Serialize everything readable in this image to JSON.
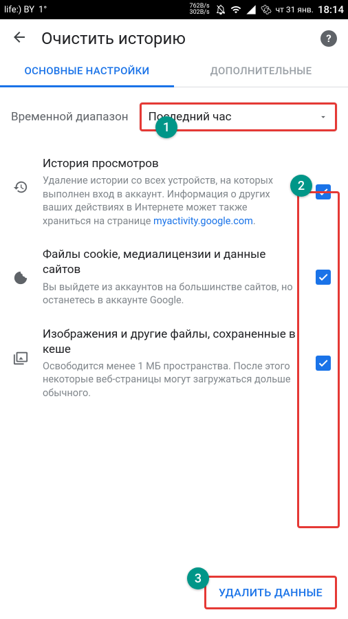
{
  "status": {
    "carrier": "life:) BY",
    "temp": "1°",
    "speed_down": "762B/s",
    "speed_up": "302B/s",
    "date": "чт 31 янв.",
    "time": "18:14"
  },
  "header": {
    "title": "Очистить историю",
    "help_glyph": "?"
  },
  "tabs": {
    "basic": "ОСНОВНЫЕ НАСТРОЙКИ",
    "advanced": "ДОПОЛНИТЕЛЬНЫЕ",
    "active": "basic"
  },
  "range": {
    "label": "Временной диапазон",
    "value": "Последний час"
  },
  "options": [
    {
      "title": "История просмотров",
      "desc_prefix": "Удаление истории со всех устройств, на которых выполнен вход в аккаунт. Информация о других ваших действиях в Интернете может также храниться на странице ",
      "desc_link": "myactivity.google.com",
      "desc_suffix": ".",
      "checked": true
    },
    {
      "title": "Файлы cookie, медиалицензии и данные сайтов",
      "desc": "Вы выйдете из аккаунтов на большинстве сайтов, но останетесь в аккаунте Google.",
      "checked": true
    },
    {
      "title": "Изображения и другие файлы, сохраненные в кеше",
      "desc": "Освободится менее 1 МБ пространства. После этого некоторые веб-страницы могут загружаться дольше обычного.",
      "checked": true
    }
  ],
  "action": {
    "delete": "УДАЛИТЬ ДАННЫЕ"
  },
  "annotations": {
    "b1": "1",
    "b2": "2",
    "b3": "3"
  }
}
